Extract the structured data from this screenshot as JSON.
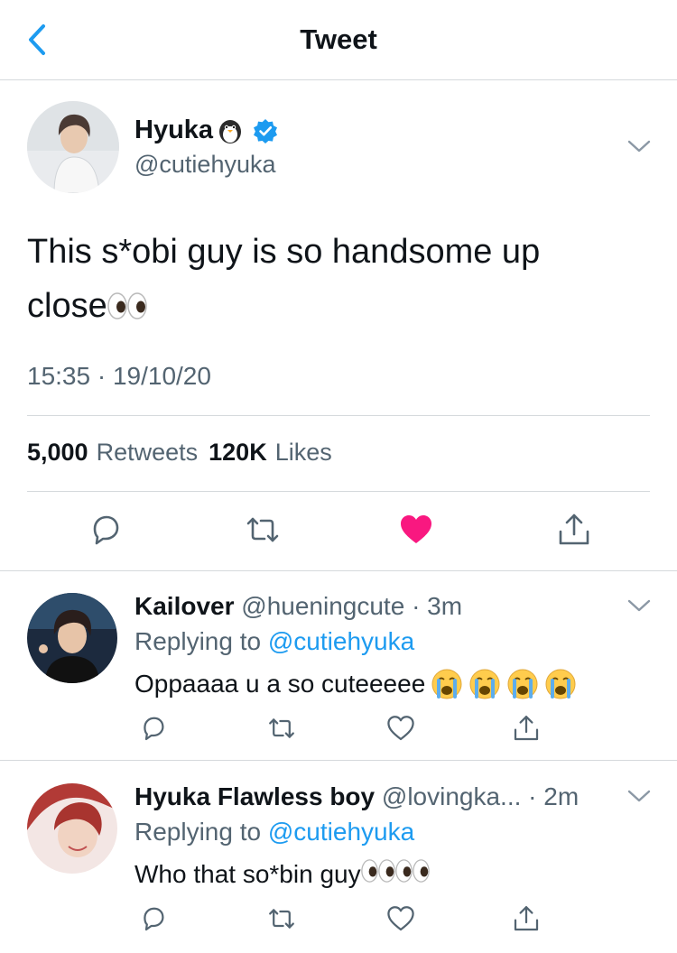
{
  "header": {
    "title": "Tweet"
  },
  "tweet": {
    "display_name": "Hyuka",
    "handle": "@cutiehyuka",
    "text_line1": "This s*obi guy is so handsome up",
    "text_line2": "close",
    "timestamp": "15:35 · 19/10/20",
    "retweets_count": "5,000",
    "retweets_label": "Retweets",
    "likes_count": "120K",
    "likes_label": "Likes",
    "liked": true
  },
  "replies": [
    {
      "display_name": "Kailover",
      "meta": "@hueningcute · 3m",
      "replying_prefix": "Replying to",
      "replying_to": "@cutiehyuka",
      "text": "Oppaaaa u a so cuteeeee"
    },
    {
      "display_name": "Hyuka Flawless boy",
      "meta": "@lovingka... · 2m",
      "replying_prefix": "Replying to",
      "replying_to": "@cutiehyuka",
      "text": "Who that so*bin guy"
    }
  ],
  "colors": {
    "accent": "#1d9bf0",
    "like": "#f91880",
    "muted": "#536471",
    "divider": "#d5d9dc"
  },
  "icons": [
    "back-icon",
    "verified-badge-icon",
    "penguin-emoji",
    "chevron-down-icon",
    "reply-icon",
    "retweet-icon",
    "like-icon",
    "share-icon",
    "eyes-emoji",
    "sob-emoji"
  ]
}
